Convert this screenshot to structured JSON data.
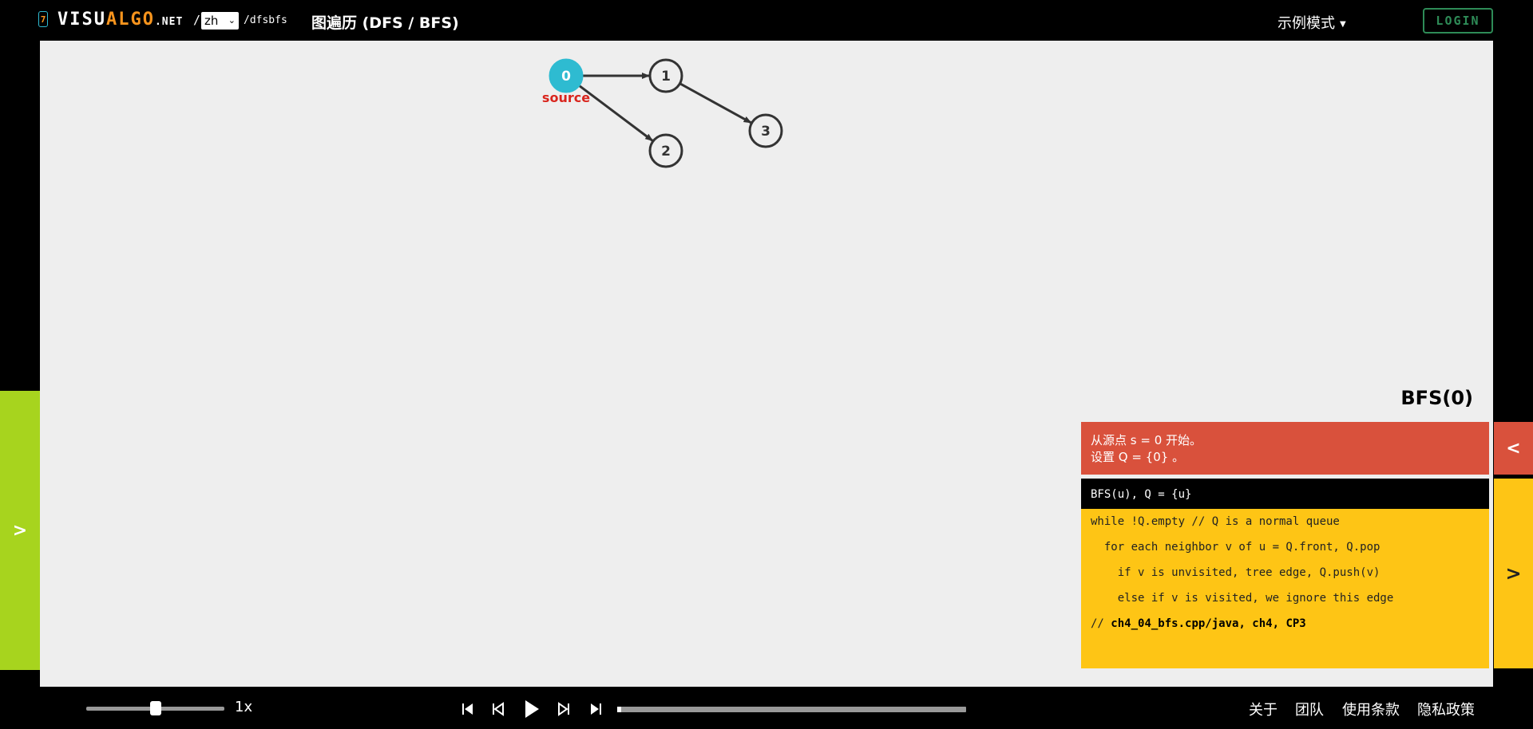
{
  "header": {
    "logo_badge": "7",
    "logo_visu": "VISU",
    "logo_algo": "ALGO",
    "logo_net": ".NET",
    "logo_slash": "/",
    "language": "zh",
    "path": "/dfsbfs",
    "page_title": "图遍历 (DFS / BFS)",
    "mode": "示例模式",
    "login_label": "LOGIN"
  },
  "graph": {
    "vertices": [
      {
        "id": "0",
        "label": "0",
        "highlighted": true,
        "sublabel": "source"
      },
      {
        "id": "1",
        "label": "1"
      },
      {
        "id": "2",
        "label": "2"
      },
      {
        "id": "3",
        "label": "3"
      }
    ],
    "edges": [
      {
        "from": "0",
        "to": "1"
      },
      {
        "from": "0",
        "to": "2"
      },
      {
        "from": "1",
        "to": "3"
      }
    ]
  },
  "left_tab": {
    "label": ">"
  },
  "status": {
    "algorithm": "BFS(0)",
    "line1": "从源点 s = 0 开始。",
    "line2": "设置 Q = {0} 。"
  },
  "status_collapse_label": "<",
  "code": {
    "lines": [
      "BFS(u), Q = {u}",
      "while !Q.empty // Q is a normal queue",
      "  for each neighbor v of u = Q.front, Q.pop",
      "    if v is unvisited, tree edge, Q.push(v)",
      "    else if v is visited, we ignore this edge"
    ],
    "comment_prefix": "// ",
    "comment_bold": "ch4_04_bfs.cpp/java, ch4, CP3",
    "active_line": 0
  },
  "code_collapse_label": ">",
  "playback": {
    "speed_label": "1x",
    "speed_level": 0.5,
    "progress": 0.01
  },
  "footer": {
    "about": "关于",
    "team": "团队",
    "terms": "使用条款",
    "privacy": "隐私政策"
  },
  "colors": {
    "highlight": "#2ebbd1",
    "source_label": "#d9251d",
    "left_tab": "#a7d41e",
    "status": "#d9513c",
    "code_panel": "#fec515",
    "login": "#2e8b57",
    "logo_accent": "#f7941d"
  },
  "icons": {
    "go_to_beginning": "skip-back-icon",
    "previous_step": "step-back-icon",
    "play": "play-icon",
    "next_step": "step-forward-icon",
    "go_to_end": "skip-forward-icon"
  }
}
